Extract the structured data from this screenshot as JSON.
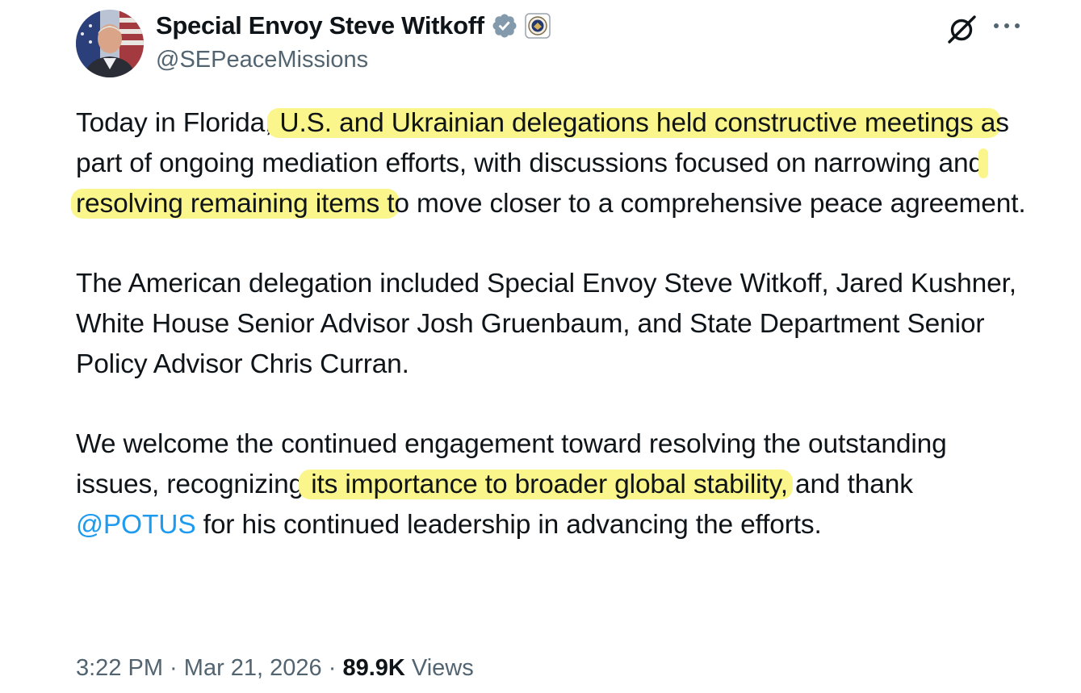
{
  "author": {
    "name": "Special Envoy Steve Witkoff",
    "handle": "@SEPeaceMissions",
    "avatar_icon": "profile-photo",
    "verified_icon": "verified-badge-gray",
    "affiliation_icon": "state-department-seal"
  },
  "toolbar": {
    "grok_icon": "grok-icon",
    "more_icon": "more-dots-icon"
  },
  "colors": {
    "text": "#0f1419",
    "secondary": "#536471",
    "mention": "#1d9bf0",
    "highlight": "#fbf68c",
    "verified_badge": "#829aab"
  },
  "post": {
    "p1": {
      "t1": "Today in Florida,",
      "h1": " U.S. and Ukrainian delegations held constructive meetings a",
      "t2": "s part of ongoing mediation efforts, with discussions focused on narrowing and",
      "h2": " resolving remaining items t",
      "t3": "o move closer to a comprehensive peace agreement."
    },
    "p2": "The American delegation included Special Envoy Steve Witkoff, Jared Kushner, White House Senior Advisor Josh Gruenbaum, and State Department Senior Policy Advisor Chris Curran.",
    "p3": {
      "t1": "We welcome the continued engagement toward resolving the outstanding issues, recognizing",
      "h1": " its importance to broader global stability,",
      "t2": " and thank ",
      "mention": "@POTUS",
      "t3": " for his continued leadership in advancing the efforts."
    }
  },
  "meta": {
    "time": "3:22 PM",
    "sep1": " · ",
    "date": "Mar 21, 2026",
    "sep2": " · ",
    "views_count": "89.9K",
    "views_label": " Views"
  }
}
